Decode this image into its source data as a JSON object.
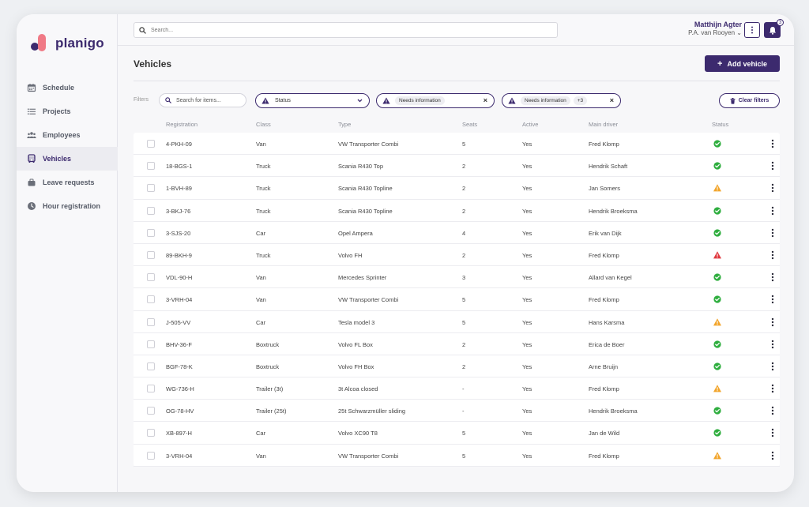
{
  "app": {
    "logo_text": "planigo",
    "brand_color": "#3c2a6e",
    "accent_color": "#f07a86"
  },
  "sidebar": {
    "items": [
      {
        "label": "Schedule",
        "icon": "calendar-icon",
        "active": false
      },
      {
        "label": "Projects",
        "icon": "list-icon",
        "active": false
      },
      {
        "label": "Employees",
        "icon": "people-icon",
        "active": false
      },
      {
        "label": "Vehicles",
        "icon": "bus-icon",
        "active": true
      },
      {
        "label": "Leave requests",
        "icon": "suitcase-icon",
        "active": false
      },
      {
        "label": "Hour registration",
        "icon": "clock-icon",
        "active": false
      }
    ]
  },
  "topbar": {
    "search_placeholder": "Search...",
    "user_name": "Matthijn Agter",
    "user_org": "P.A. van Rooyen ⌄",
    "notification_count": "3"
  },
  "page": {
    "title": "Vehicles",
    "add_button_label": "Add vehicle",
    "filters_label": "Filters",
    "filter_search_placeholder": "Search for items...",
    "filter_status_label": "Status",
    "filter_chip_1": "Needs information",
    "filter_chip_2": "Needs information",
    "filter_chip_2_more": "+3",
    "clear_filters_label": "Clear filters"
  },
  "table": {
    "columns": [
      "Registration",
      "Class",
      "Type",
      "Seats",
      "Active",
      "Main driver",
      "Status"
    ],
    "rows": [
      {
        "registration": "4-PKH-09",
        "class": "Van",
        "type": "VW Transporter Combi",
        "seats": "5",
        "active": "Yes",
        "driver": "Fred Klomp",
        "status": "ok"
      },
      {
        "registration": "18-BGS-1",
        "class": "Truck",
        "type": "Scania R430 Top",
        "seats": "2",
        "active": "Yes",
        "driver": "Hendrik Schaft",
        "status": "ok"
      },
      {
        "registration": "1-BVH-89",
        "class": "Truck",
        "type": "Scania R430 Topline",
        "seats": "2",
        "active": "Yes",
        "driver": "Jan Somers",
        "status": "warning"
      },
      {
        "registration": "3-BKJ-76",
        "class": "Truck",
        "type": "Scania R430 Topline",
        "seats": "2",
        "active": "Yes",
        "driver": "Hendrik Broeksma",
        "status": "ok"
      },
      {
        "registration": "3-SJS-20",
        "class": "Car",
        "type": "Opel Ampera",
        "seats": "4",
        "active": "Yes",
        "driver": "Erik van Dijk",
        "status": "ok"
      },
      {
        "registration": "89-BKH-9",
        "class": "Truck",
        "type": "Volvo FH",
        "seats": "2",
        "active": "Yes",
        "driver": "Fred Klomp",
        "status": "error"
      },
      {
        "registration": "VDL-90-H",
        "class": "Van",
        "type": "Mercedes Sprinter",
        "seats": "3",
        "active": "Yes",
        "driver": "Allard van Kegel",
        "status": "ok"
      },
      {
        "registration": "3-VRH-04",
        "class": "Van",
        "type": "VW Transporter Combi",
        "seats": "5",
        "active": "Yes",
        "driver": "Fred Klomp",
        "status": "ok"
      },
      {
        "registration": "J-505-VV",
        "class": "Car",
        "type": "Tesla model 3",
        "seats": "5",
        "active": "Yes",
        "driver": "Hans Karsma",
        "status": "warning"
      },
      {
        "registration": "BHV-36-F",
        "class": "Boxtruck",
        "type": "Volvo FL Box",
        "seats": "2",
        "active": "Yes",
        "driver": "Erica de Boer",
        "status": "ok"
      },
      {
        "registration": "BGF-78-K",
        "class": "Boxtruck",
        "type": "Volvo FH Box",
        "seats": "2",
        "active": "Yes",
        "driver": "Arne Bruijn",
        "status": "ok"
      },
      {
        "registration": "WG-736-H",
        "class": "Trailer (3t)",
        "type": "3t Alcoa closed",
        "seats": "-",
        "active": "Yes",
        "driver": "Fred Klomp",
        "status": "warning"
      },
      {
        "registration": "OG-78-HV",
        "class": "Trailer (25t)",
        "type": "25t Schwarzmüller sliding",
        "seats": "-",
        "active": "Yes",
        "driver": "Hendrik Broeksma",
        "status": "ok"
      },
      {
        "registration": "XB-897-H",
        "class": "Car",
        "type": "Volvo XC90 T8",
        "seats": "5",
        "active": "Yes",
        "driver": "Jan de Wild",
        "status": "ok"
      },
      {
        "registration": "3-VRH-04",
        "class": "Van",
        "type": "VW Transporter Combi",
        "seats": "5",
        "active": "Yes",
        "driver": "Fred Klomp",
        "status": "warning"
      }
    ]
  },
  "status_colors": {
    "ok": "#2fae3f",
    "warning": "#f2a52b",
    "error": "#e0383e"
  }
}
